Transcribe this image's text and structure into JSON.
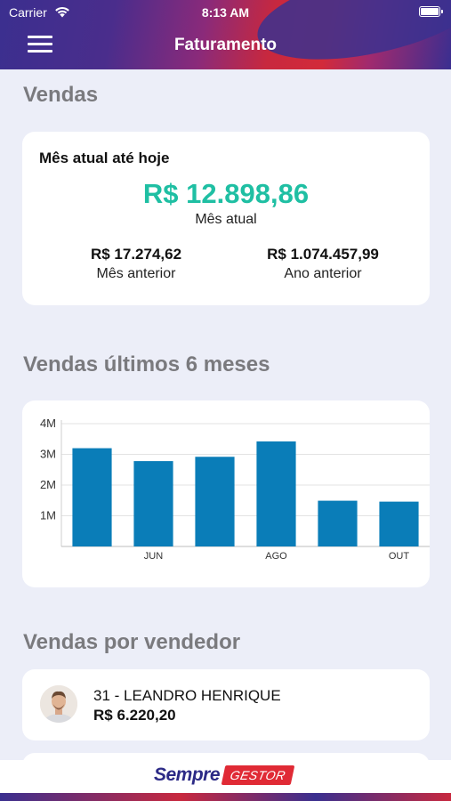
{
  "status_bar": {
    "carrier": "Carrier",
    "time": "8:13 AM"
  },
  "header": {
    "title": "Faturamento"
  },
  "sales": {
    "section_title": "Vendas",
    "heading": "Mês atual até hoje",
    "current_value": "R$ 12.898,86",
    "current_label": "Mês atual",
    "previous_month_value": "R$ 17.274,62",
    "previous_month_label": "Mês anterior",
    "previous_year_value": "R$ 1.074.457,99",
    "previous_year_label": "Ano anterior",
    "accent_color": "#1fbfa3"
  },
  "chart_section": {
    "title": "Vendas últimos 6 meses"
  },
  "chart_data": {
    "type": "bar",
    "categories": [
      "",
      "JUN",
      "",
      "AGO",
      "",
      "OUT"
    ],
    "values": [
      3200000,
      2780000,
      2920000,
      3420000,
      1490000,
      1460000
    ],
    "ylim": [
      0,
      4000000
    ],
    "y_ticks": [
      "1M",
      "2M",
      "3M",
      "4M"
    ],
    "y_tick_values": [
      1000000,
      2000000,
      3000000,
      4000000
    ],
    "grid": true,
    "bar_color": "#0a7db8"
  },
  "sellers": {
    "section_title": "Vendas por vendedor",
    "items": [
      {
        "name": "31 - LEANDRO HENRIQUE",
        "value": "R$ 6.220,20"
      }
    ]
  },
  "footer": {
    "brand_primary": "Sempre",
    "brand_secondary": "GESTOR"
  }
}
